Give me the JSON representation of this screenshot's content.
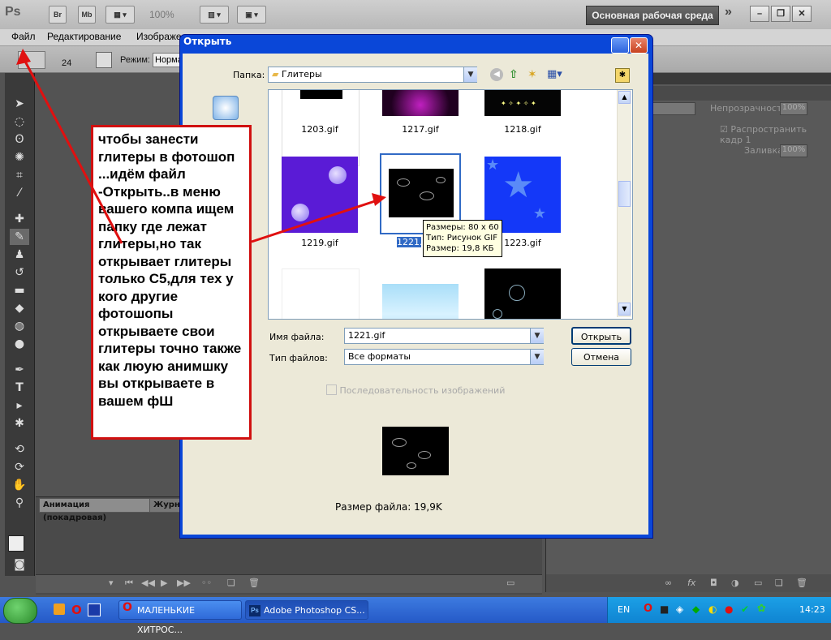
{
  "app": {
    "logo": "Ps",
    "toolbar": {
      "br": "Br",
      "mb": "Mb",
      "zoom": "100%"
    },
    "workspace": "Основная рабочая среда",
    "menu": [
      "Файл",
      "Редактирование",
      "Изображе"
    ],
    "options": {
      "size": "24",
      "mode_label": "Режим:",
      "mode_value": "Норма"
    }
  },
  "panels": {
    "animation_tab": "Анимация (покадровая)",
    "journal_tab": "Журн",
    "right": {
      "opacity_label": "Непрозрачность:",
      "opacity_value": "100%",
      "propagate_label": "Распространить кадр 1",
      "fill_label": "Заливка:",
      "fill_value": "100%"
    }
  },
  "dialog": {
    "title": "Открыть",
    "folder_label": "Папка:",
    "folder_value": "Глитеры",
    "files": [
      {
        "name": "1203.gif"
      },
      {
        "name": "1217.gif"
      },
      {
        "name": "1218.gif"
      },
      {
        "name": "1219.gif"
      },
      {
        "name": "1221.gif"
      },
      {
        "name": "1223.gif"
      }
    ],
    "tooltip": {
      "size": "Размеры: 80 x 60",
      "type": "Тип: Рисунок GIF",
      "weight": "Размер: 19,8 КБ"
    },
    "filename_label": "Имя файла:",
    "filename_value": "1221.gif",
    "filetype_label": "Тип файлов:",
    "filetype_value": "Все форматы",
    "open_button": "Открыть",
    "cancel_button": "Отмена",
    "sequence_label": "Последовательность изображений",
    "filesize": "Размер файла: 19,9K"
  },
  "annotation": "чтобы занести глитеры в фотошоп  ...идём файл -Открыть..в меню вашего компа ищем папку где лежат глитеры,но так открывает глитеры только C5,для тех у кого другие фотошопы открываете свои глитеры точно также как люую анимшку вы открываете в вашем фШ",
  "taskbar": {
    "task1": "МАЛЕНЬКИЕ ХИТРОС...",
    "task2": "Adobe Photoshop CS...",
    "lang": "EN",
    "clock": "14:23"
  },
  "colors": {
    "annotation_border": "#d01010",
    "xp_title": "#0a47d8",
    "taskbar": "#2559c7"
  }
}
